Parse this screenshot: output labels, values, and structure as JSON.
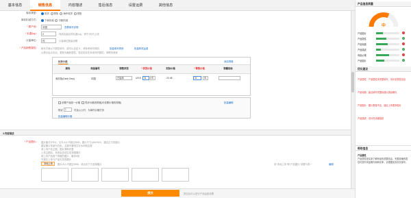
{
  "tabs": [
    "基本信息",
    "销售信息",
    "内容描述",
    "售后信息",
    "设置运费",
    "其他信息"
  ],
  "sales": {
    "stock_type_label": "库存类型：",
    "stock_type_opts": [
      "现货",
      "预售",
      "海外现货",
      "预售"
    ],
    "reduce_label": "库存扣减方式：",
    "reduce_opts": [
      "下单扣减",
      "付款扣减"
    ],
    "origin_label": "* 原产地：",
    "origin_value": "中国",
    "origin_link": "查看填写说明",
    "weight_label": "* 毛重(kg)：",
    "weight_value": "0",
    "weight_hint": "商品包装后的毛重(kg)，请于3天内上线",
    "unit_label": "计量单位：",
    "unit_value": "件",
    "unit_hint": "计量单位数量设置",
    "attr_label": "* 产品销售属性：",
    "attr_hint1": "填写方案以下属性填写，或可以自定义，请参考填写规则",
    "attr_hint2": "以提示后点击后，更新为最新属性。若实际存在未填写的属性，请联系卖家",
    "attr_link1": "批量填写规则",
    "attr_link2": "批量修改运费"
  },
  "table": {
    "tab": "标准价格",
    "add_link": "添加规格",
    "headers": [
      "颜色",
      "商品编号",
      "销售状态",
      "* 供货价格",
      "实际价格",
      "* 零售价格",
      "销量指标"
    ],
    "row": {
      "color": "深灰色(Dark Grey)",
      "code": "中国",
      "status": "已启用",
      "price_pre": "US $",
      "price": "31",
      "price_unit": "件",
      "real_price": "22.48",
      "retail": "31",
      "retail_unit": "件"
    }
  },
  "stock": {
    "check1": "设置产品统一价格",
    "check2": "同步价格到规格(可设置价格的规格)",
    "link": "批量编辑",
    "qty_pre": "购买",
    "qty_value": "1",
    "qty_mid": "件及以上时，为单件价格打折",
    "link2": "批量编辑价格"
  },
  "content": {
    "section_title": "3.内容描述",
    "pic_label": "* 产品图片：",
    "pic_hints": [
      "图片格式JPEG，文件大小不超过5MB，图片尺寸≥800*800，建议正方形图片",
      "建议图片背景为白色，主图不要带文字水印和边框",
      "请上传产品主图，图片清晰完整",
      "上传主图后，系统会自动生成多图展示",
      "请上传产品各个角度的图片，最多6张",
      "不建议上传与产品无关的图片"
    ],
    "upload_btn": "本地上传",
    "upload_hint": "图片大小不超过5MB，请点击下方选择图片",
    "right_hint": "将\"本地上传\"和\"产品图片\"设置为同一",
    "right_link": "编辑",
    "submit": "提交",
    "submit_note": "提交后可以进行产品运费设置"
  },
  "side": {
    "title": "产品信息质量",
    "score_label": "中",
    "metrics": [
      {
        "label": "产品图片",
        "value": 0.3
      },
      {
        "label": "产品属性",
        "value": 0.45
      },
      {
        "label": "产品标题",
        "value": 0.5
      },
      {
        "label": "产品描述",
        "value": 0.2
      },
      {
        "label": "商品价格",
        "value": 0.55
      },
      {
        "label": "产品图片",
        "value": 0.35
      }
    ],
    "suggest_title": "优化建议",
    "suggest_items": [
      "产品属性：产品属性未完整填写，请补全属性信息",
      "产品标题：建议填写完整标题以提高曝光",
      "产品图片：图片数量不足，建议上传更多图片",
      "产品描述：请补充详细描述"
    ],
    "help_title": "帮助信息",
    "help_subtitle": "产品属性",
    "help_text": "产品属性是买家了解商品的重要信息，完整准确的属性可提升商品曝光和转化率，请根据实际情况填写。",
    "colors": {
      "accent": "#ff7a00",
      "good": "#3aa757",
      "bad": "#e33333",
      "link": "#1a6fc9"
    }
  }
}
